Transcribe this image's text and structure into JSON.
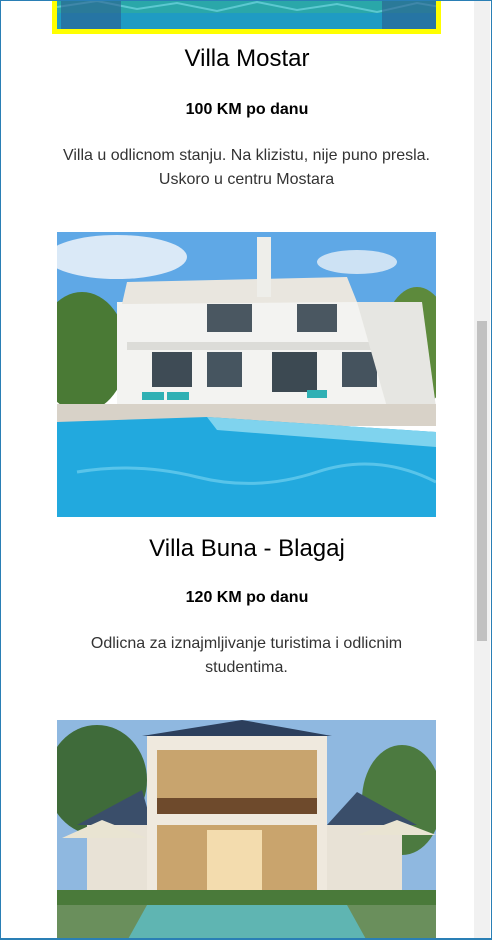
{
  "listings": [
    {
      "title": "Villa Mostar",
      "price": "100 KM po danu",
      "description": "Villa u odlicnom stanju. Na klizistu, nije puno presla. Uskoro u centru Mostara"
    },
    {
      "title": "Villa Buna - Blagaj",
      "price": "120 KM po danu",
      "description": "Odlicna za iznajmljivanje turistima i odlicnim studentima."
    },
    {
      "title": "",
      "price": "",
      "description": ""
    }
  ],
  "colors": {
    "frame_border": "#2a7fb5",
    "highlight_border": "#ffff00",
    "pool": "#22a9de"
  }
}
